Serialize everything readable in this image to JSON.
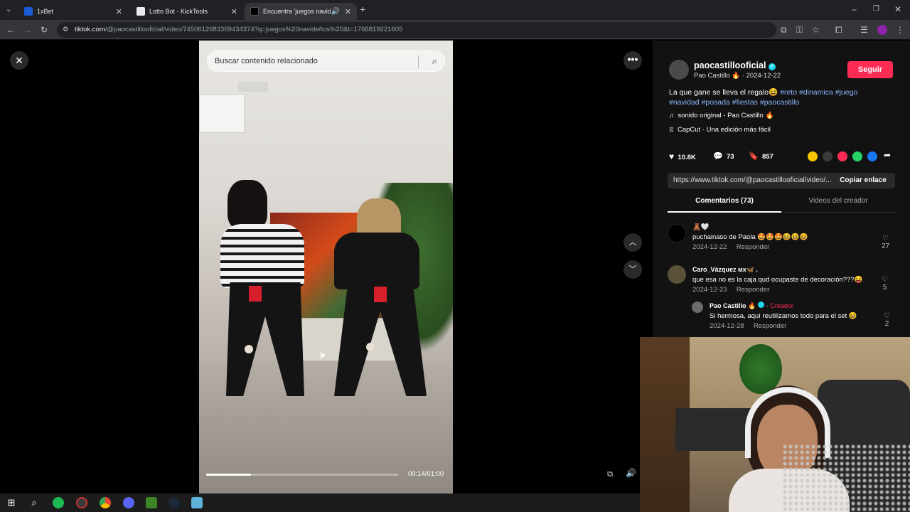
{
  "browser": {
    "tabs": [
      {
        "title": "1xBet",
        "favicon_color": "#1a5bd8",
        "active": false
      },
      {
        "title": "Lotto Bot - KickTools",
        "favicon_color": "#e8eaed",
        "active": false
      },
      {
        "title": "Encuentra 'juegos navideño",
        "favicon_color": "#000000",
        "active": true
      }
    ],
    "url_host": "tiktok.com",
    "url_path": "/@paocastillooficial/video/7450612683369434374?q=juegos%20navideños%20&t=1766819221605"
  },
  "video": {
    "search_placeholder": "Buscar contenido relacionado",
    "time": "00:14/01:00",
    "progress": 0.233
  },
  "post": {
    "username": "paocastillooficial",
    "display_name": "Pao Castillo 🔥",
    "date": "2024-12-22",
    "follow_label": "Seguir",
    "caption_text": "La que gane se lleva el regalo😆 ",
    "hashtags_line1": "#reto #dinamica #juego",
    "hashtags_line2": "#navidad #posada #fiestas #paocastillo",
    "sound": "sonido original - Pao Castillo 🔥",
    "capcut": "CapCut · Una edición más fácil",
    "likes": "10.8K",
    "comments": "73",
    "saves": "857",
    "share_link": "https://www.tiktok.com/@paocastillooficial/video/...",
    "copy_label": "Copiar enlace",
    "tab_comments": "Comentarios (73)",
    "tab_creator_videos": "Videos del creador"
  },
  "comments": [
    {
      "author": "🧸🤍",
      "text": "puchainaso de Paola 🤩🤩🤩😆😆😆",
      "date": "2024-12-22",
      "reply": "Responder",
      "likes": "27"
    },
    {
      "author": "Caro_Vázquez ᴍx🦋 .",
      "text": "que esa no es la caja qud ocupaste de decoración???😝",
      "date": "2024-12-23",
      "reply": "Responder",
      "likes": "5"
    },
    {
      "author": "Pao Castillo 🔥",
      "badge": "Creador",
      "text": "Si hermosa, aquí reutilizamos todo para el set 😆",
      "date": "2024-12-28",
      "reply": "Responder",
      "likes": "2"
    }
  ],
  "colors": {
    "accent": "#fe2c55",
    "link": "#8ab4f8",
    "verified": "#20d5ec"
  }
}
